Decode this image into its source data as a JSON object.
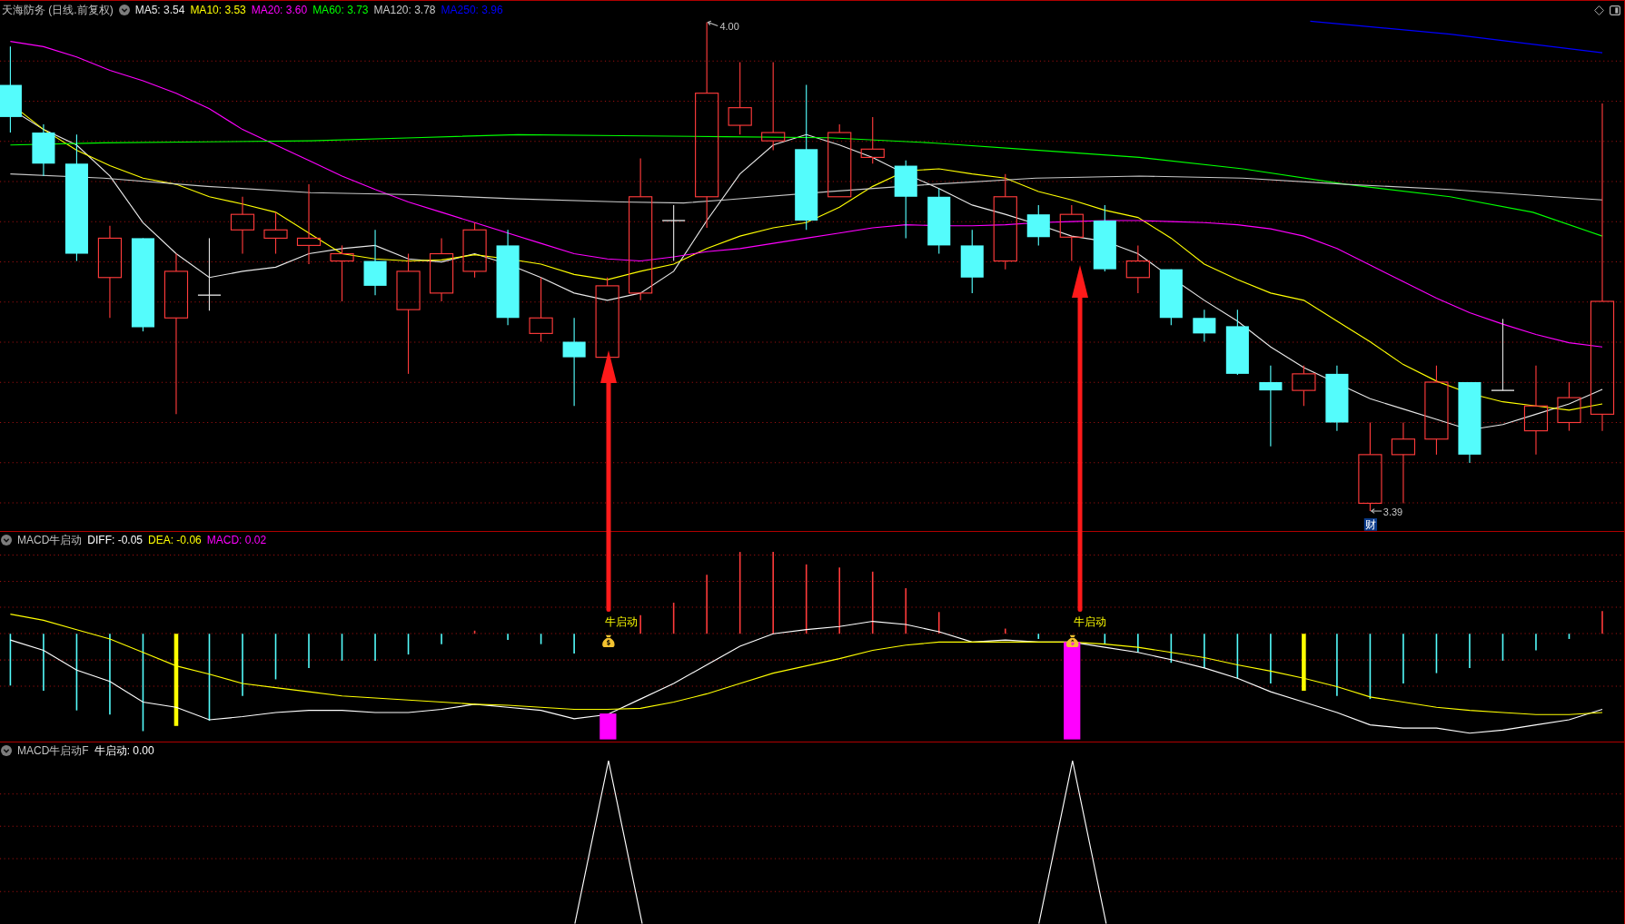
{
  "main_chart": {
    "title": "天海防务 (日线.前复权)",
    "indicators": [
      {
        "label": "MA5: 3.54",
        "color": "#e8e8e8"
      },
      {
        "label": "MA10: 3.53",
        "color": "#ffff00"
      },
      {
        "label": "MA20: 3.60",
        "color": "#ff00ff"
      },
      {
        "label": "MA60: 3.73",
        "color": "#00ff00"
      },
      {
        "label": "MA120: 3.78",
        "color": "#c8c8c8"
      },
      {
        "label": "MA250: 3.96",
        "color": "#0000ff"
      }
    ],
    "high_price": "4.00",
    "low_price": "3.39",
    "event_tag": "财"
  },
  "macd_chart": {
    "title": "MACD牛启动",
    "indicators": [
      {
        "label": "DIFF: -0.05",
        "color": "#ffffff"
      },
      {
        "label": "DEA: -0.06",
        "color": "#ffff00"
      },
      {
        "label": "MACD: 0.02",
        "color": "#ff00ff"
      }
    ],
    "signals": [
      {
        "label": "牛启动"
      },
      {
        "label": "牛启动"
      }
    ]
  },
  "signal_chart": {
    "title": "MACD牛启动F",
    "indicators": [
      {
        "label": "牛启动: 0.00",
        "color": "#ffffff"
      }
    ]
  }
}
